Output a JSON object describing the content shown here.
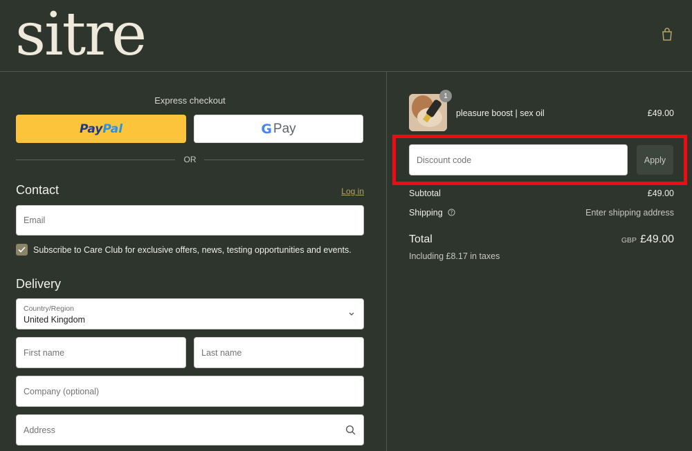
{
  "brand": {
    "logo_text": "sitre"
  },
  "header": {
    "cart_icon": "shopping-bag-icon"
  },
  "express": {
    "label": "Express checkout",
    "paypal": {
      "part1": "Pay",
      "part2": "Pal"
    },
    "gpay": {
      "g": "G",
      "pay": "Pay"
    },
    "or": "OR"
  },
  "contact": {
    "title": "Contact",
    "login_link": "Log in",
    "email_placeholder": "Email",
    "subscribe_label": "Subscribe to Care Club for exclusive offers, news, testing opportunities and events.",
    "subscribe_checked": true
  },
  "delivery": {
    "title": "Delivery",
    "country_label": "Country/Region",
    "country_value": "United Kingdom",
    "first_name_placeholder": "First name",
    "last_name_placeholder": "Last name",
    "company_placeholder": "Company (optional)",
    "address_placeholder": "Address"
  },
  "summary": {
    "product": {
      "name": "pleasure boost | sex oil",
      "price": "£49.00",
      "quantity": "1"
    },
    "discount": {
      "placeholder": "Discount code",
      "apply_label": "Apply"
    },
    "subtotal": {
      "label": "Subtotal",
      "value": "£49.00"
    },
    "shipping": {
      "label": "Shipping",
      "value": "Enter shipping address"
    },
    "total": {
      "label": "Total",
      "currency": "GBP",
      "value": "£49.00",
      "taxes": "Including £8.17 in taxes"
    }
  },
  "colors": {
    "background": "#2d352d",
    "paypal_yellow": "#fcc43a",
    "highlight": "#ef0a14",
    "accent_link": "#b8a36a"
  }
}
